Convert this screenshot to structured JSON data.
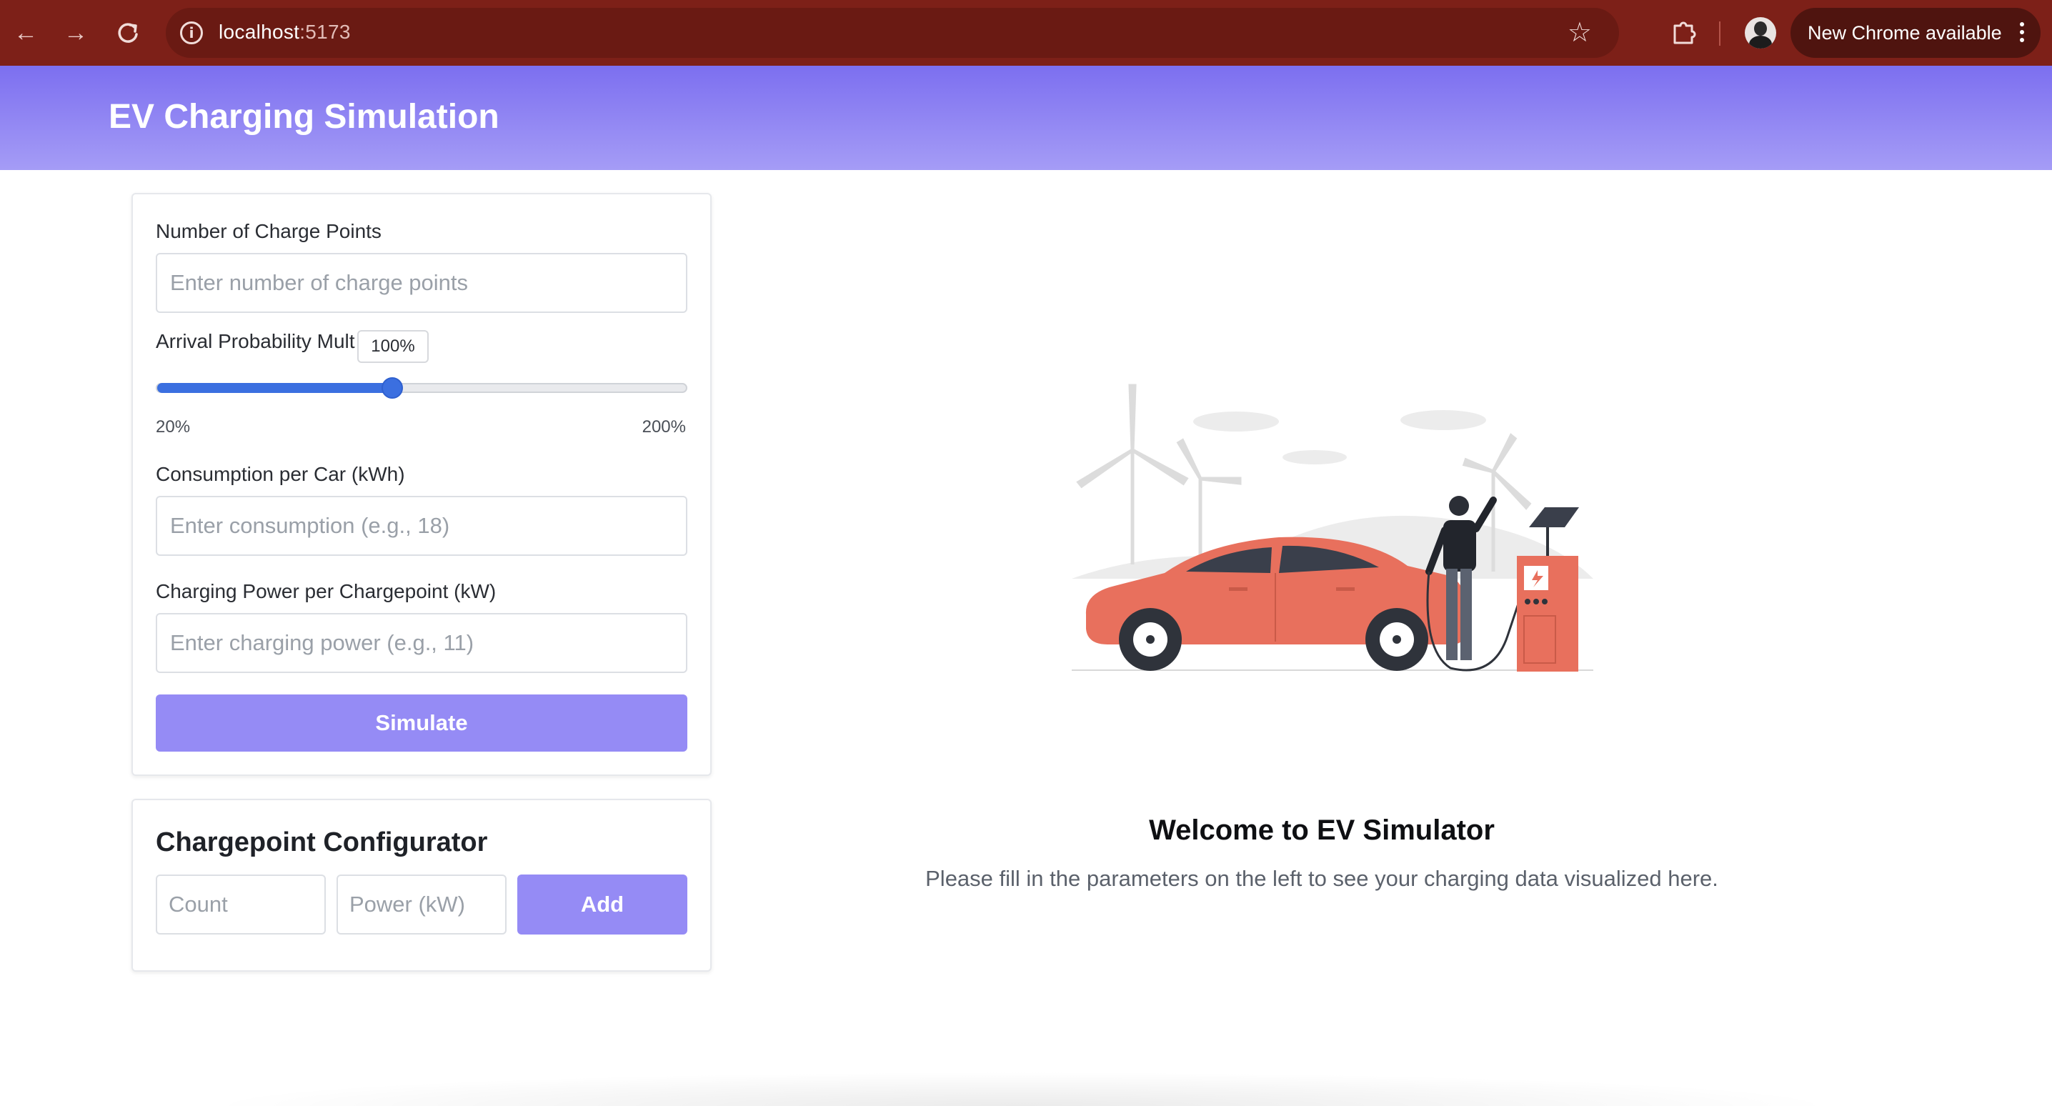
{
  "browser": {
    "url_host": "localhost",
    "url_port": ":5173",
    "update_label": "New Chrome available"
  },
  "header": {
    "title": "EV Charging Simulation"
  },
  "form": {
    "charge_points_label": "Number of Charge Points",
    "charge_points_placeholder": "Enter number of charge points",
    "arrival_label": "Arrival Probability Multiplier",
    "arrival_value": "100%",
    "arrival_min": "20%",
    "arrival_max": "200%",
    "arrival_fraction": 0.4444,
    "consumption_label": "Consumption per Car (kWh)",
    "consumption_placeholder": "Enter consumption (e.g., 18)",
    "power_label": "Charging Power per Chargepoint (kW)",
    "power_placeholder": "Enter charging power (e.g., 11)",
    "simulate_label": "Simulate"
  },
  "configurator": {
    "title": "Chargepoint Configurator",
    "count_placeholder": "Count",
    "power_placeholder": "Power (kW)",
    "add_label": "Add"
  },
  "welcome": {
    "title": "Welcome to EV Simulator",
    "text": "Please fill in the parameters on the left to see your charging data visualized here."
  },
  "colors": {
    "chrome": "#7d2018",
    "header_start": "#7c6ff0",
    "header_end": "#a59cf6",
    "button": "#958bf5",
    "slider": "#3b6fe0",
    "car": "#e8705d"
  }
}
